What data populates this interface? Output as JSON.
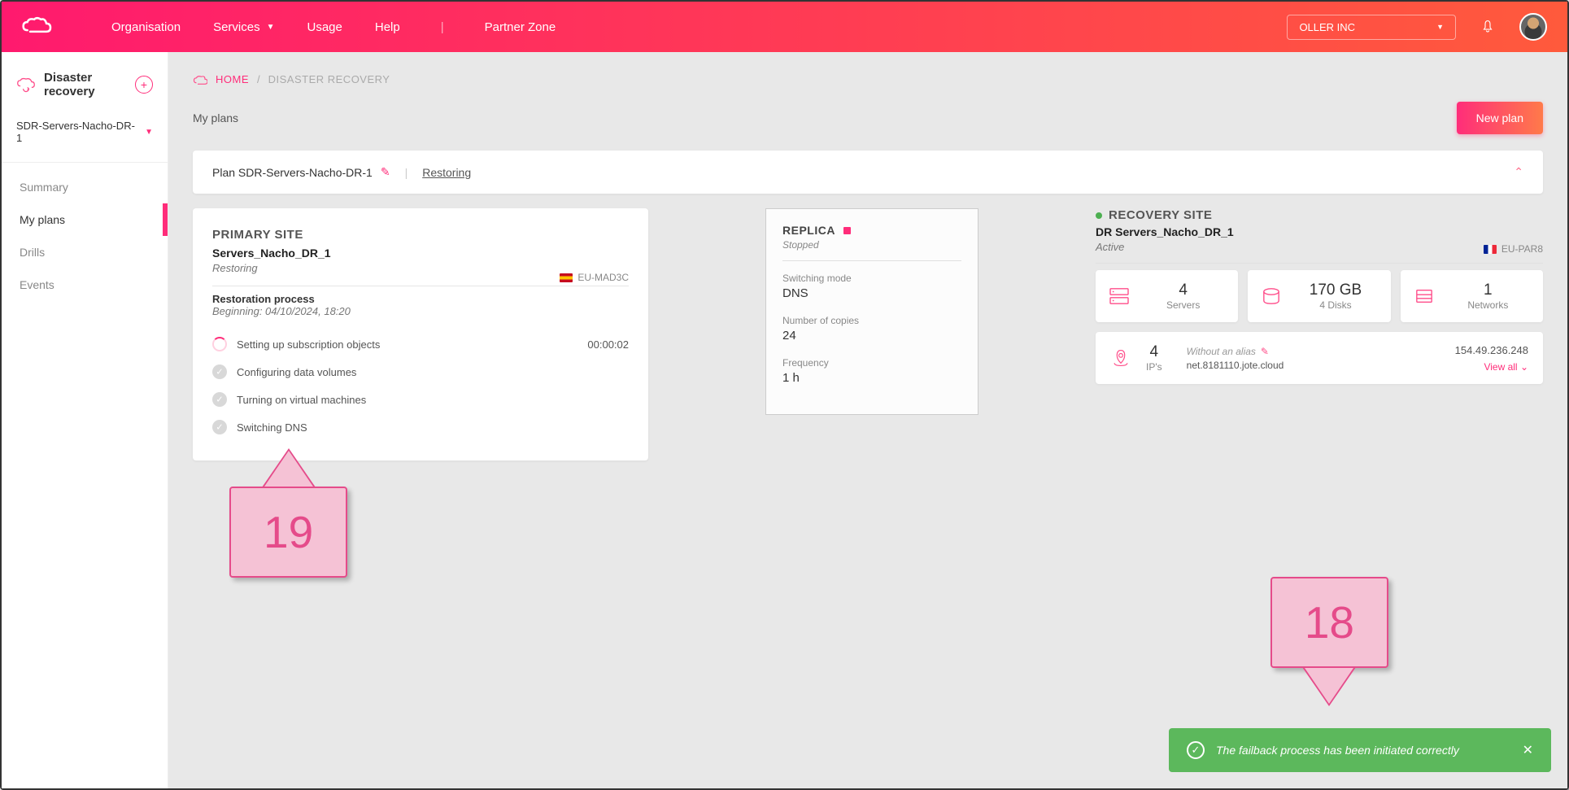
{
  "topbar": {
    "nav": {
      "organisation": "Organisation",
      "services": "Services",
      "usage": "Usage",
      "help": "Help",
      "partner": "Partner Zone"
    },
    "org_name": "OLLER INC"
  },
  "sidebar": {
    "title": "Disaster recovery",
    "plan_select": "SDR-Servers-Nacho-DR-1",
    "items": {
      "summary": "Summary",
      "myplans": "My plans",
      "drills": "Drills",
      "events": "Events"
    }
  },
  "breadcrumb": {
    "home": "HOME",
    "current": "DISASTER RECOVERY"
  },
  "section": {
    "title": "My plans",
    "new_plan": "New plan"
  },
  "planbar": {
    "label": "Plan SDR-Servers-Nacho-DR-1",
    "status": "Restoring"
  },
  "primary": {
    "title": "PRIMARY SITE",
    "name": "Servers_Nacho_DR_1",
    "status": "Restoring",
    "region": "EU-MAD3C",
    "process_title": "Restoration process",
    "process_sub": "Beginning: 04/10/2024, 18:20",
    "steps": {
      "s1": "Setting up subscription objects",
      "s1_time": "00:00:02",
      "s2": "Configuring data volumes",
      "s3": "Turning on virtual machines",
      "s4": "Switching DNS"
    }
  },
  "replica": {
    "title": "REPLICA",
    "status": "Stopped",
    "switching_label": "Switching mode",
    "switching_value": "DNS",
    "copies_label": "Number of copies",
    "copies_value": "24",
    "freq_label": "Frequency",
    "freq_value": "1 h"
  },
  "recovery": {
    "title": "RECOVERY SITE",
    "name": "DR Servers_Nacho_DR_1",
    "status": "Active",
    "region": "EU-PAR8",
    "servers_value": "4",
    "servers_label": "Servers",
    "storage_value": "170 GB",
    "storage_label": "4 Disks",
    "networks_value": "1",
    "networks_label": "Networks",
    "ips_value": "4",
    "ips_label": "IP's",
    "alias_label": "Without an alias",
    "host": "net.8181110.jote.cloud",
    "ip": "154.49.236.248",
    "view_all": "View all"
  },
  "callouts": {
    "c19": "19",
    "c18": "18"
  },
  "toast": {
    "message": "The failback process has been initiated correctly"
  }
}
